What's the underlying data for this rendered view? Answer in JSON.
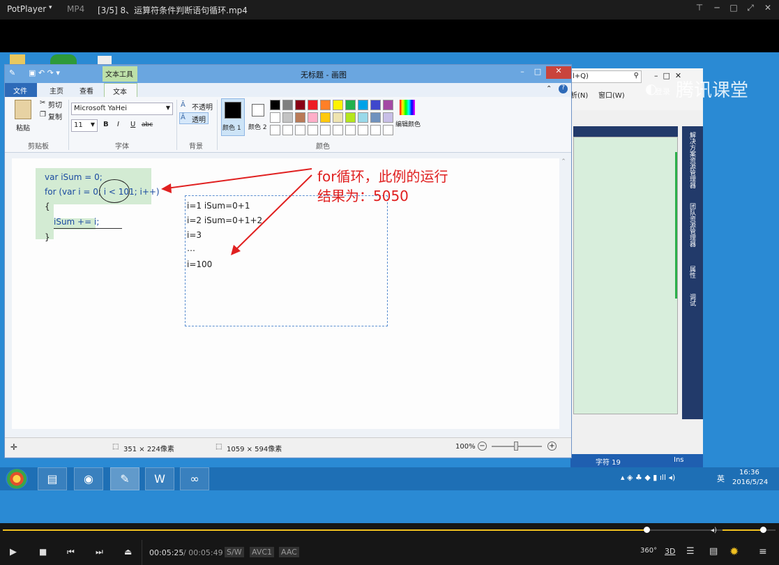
{
  "player": {
    "app_name": "PotPlayer",
    "format": "MP4",
    "file_title": "[3/5] 8、运算符条件判断语句循环.mp4",
    "time_current": "00:05:25",
    "time_total": "/ 00:05:49",
    "sw": "S/W",
    "video_codec": "AVC1",
    "audio_codec": "AAC",
    "btn_360": "360°",
    "btn_3d": "3D",
    "progress_fraction": 0.833,
    "volume_fraction": 0.8
  },
  "watermark": {
    "login": "登录",
    "brand": "腾讯课堂"
  },
  "paint": {
    "title": "无标题 - 画图",
    "tool_context_tab": "文本工具",
    "tabs": [
      "文件",
      "主页",
      "查看",
      "文本"
    ],
    "clipboard": {
      "paste": "粘贴",
      "cut": "剪切",
      "copy": "复制",
      "group": "剪贴板"
    },
    "font": {
      "family": "Microsoft YaHei",
      "size": "11",
      "bold": "B",
      "italic": "I",
      "underline": "U",
      "strike": "abc",
      "group": "字体"
    },
    "background": {
      "opaque": "不透明",
      "transparent": "透明",
      "group": "背景"
    },
    "colors": {
      "color1": "颜色 1",
      "color2": "颜色 2",
      "edit": "编辑颜色",
      "group": "颜色",
      "palette_row1": [
        "#000000",
        "#7f7f7f",
        "#880015",
        "#ed1c24",
        "#ff7f27",
        "#fff200",
        "#22b14c",
        "#00a2e8",
        "#3f48cc",
        "#a349a4"
      ],
      "palette_row2": [
        "#ffffff",
        "#c3c3c3",
        "#b97a57",
        "#ffaec9",
        "#ffc90e",
        "#efe4b0",
        "#b5e61d",
        "#99d9ea",
        "#7092be",
        "#c8bfe7"
      ]
    },
    "code_lines": [
      "var iSum = 0;",
      "for (var i = 0; i < 101; i++)",
      "{",
      "iSum += i;",
      "}"
    ],
    "text_box_lines": [
      "i=1  iSum=0+1",
      "i=2  iSum=0+1+2",
      "i=3",
      "…",
      "i=100"
    ],
    "annotation": [
      "for循环，此例的运行",
      "结果为：5050"
    ],
    "status": {
      "selection": "351 × 224像素",
      "canvas_size": "1059 × 594像素",
      "zoom": "100%"
    }
  },
  "vs": {
    "search_hint": "l+Q)",
    "menu_n": "析(N)",
    "menu_w": "窗口(W)",
    "side_tabs": [
      "解决方案资源管理器",
      "团队资源管理器",
      "属性",
      "调试"
    ],
    "status_char": "字符 19",
    "status_ins": "Ins"
  },
  "taskbar": {
    "clock_time": "16:36",
    "clock_date": "2016/5/24",
    "ime": "英"
  },
  "colors": {
    "accent": "#f0c020",
    "arrow": "#e02020"
  }
}
